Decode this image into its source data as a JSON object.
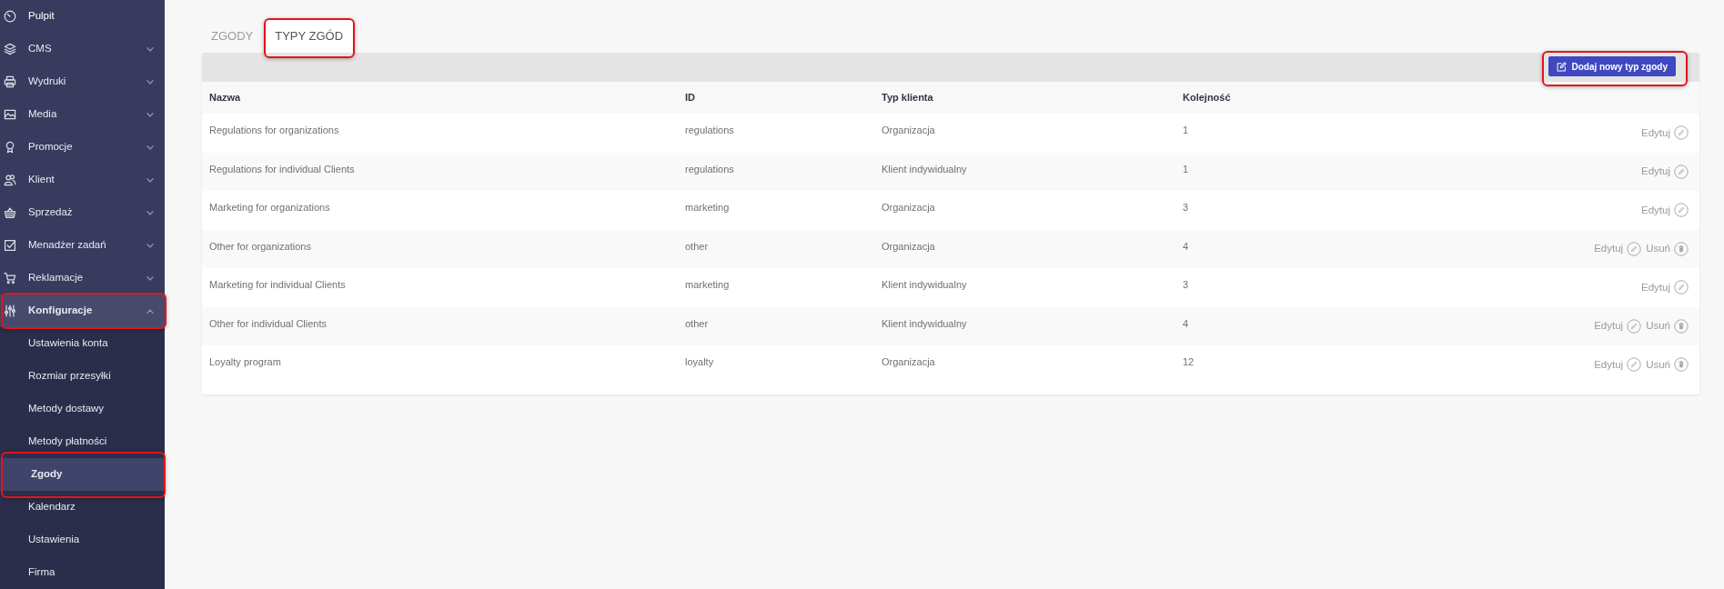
{
  "sidebar": {
    "items": [
      {
        "label": "Pulpit",
        "kind": "link",
        "highlighted": false
      },
      {
        "label": "CMS",
        "kind": "group",
        "expanded": false,
        "highlighted": false
      },
      {
        "label": "Wydruki",
        "kind": "group",
        "expanded": false,
        "highlighted": false
      },
      {
        "label": "Media",
        "kind": "group",
        "expanded": false,
        "highlighted": false
      },
      {
        "label": "Promocje",
        "kind": "group",
        "expanded": false,
        "highlighted": false
      },
      {
        "label": "Klient",
        "kind": "group",
        "expanded": false,
        "highlighted": false
      },
      {
        "label": "Sprzedaż",
        "kind": "group",
        "expanded": false,
        "highlighted": false
      },
      {
        "label": "Menadżer zadań",
        "kind": "group",
        "expanded": false,
        "highlighted": false
      },
      {
        "label": "Reklamacje",
        "kind": "group",
        "expanded": false,
        "highlighted": false
      },
      {
        "label": "Konfiguracje",
        "kind": "group",
        "expanded": true,
        "highlighted": true,
        "children": [
          {
            "label": "Ustawienia konta",
            "selected": false,
            "highlighted": false
          },
          {
            "label": "Rozmiar przesyłki",
            "selected": false,
            "highlighted": false
          },
          {
            "label": "Metody dostawy",
            "selected": false,
            "highlighted": false
          },
          {
            "label": "Metody płatności",
            "selected": false,
            "highlighted": false
          },
          {
            "label": "Zgody",
            "selected": true,
            "highlighted": true
          },
          {
            "label": "Kalendarz",
            "selected": false,
            "highlighted": false
          },
          {
            "label": "Ustawienia",
            "selected": false,
            "highlighted": false
          },
          {
            "label": "Firma",
            "selected": false,
            "highlighted": false
          }
        ]
      }
    ]
  },
  "tabs": [
    {
      "label": "ZGODY",
      "selected": false,
      "highlighted": false
    },
    {
      "label": "TYPY ZGÓD",
      "selected": true,
      "highlighted": true
    }
  ],
  "toolbar": {
    "add_button": {
      "label": "Dodaj nowy typ zgody",
      "highlighted": true
    }
  },
  "table": {
    "columns": [
      "Nazwa",
      "ID",
      "Typ klienta",
      "Kolejność"
    ],
    "rows": [
      {
        "cells": [
          "Regulations for organizations",
          "regulations",
          "Organizacja",
          "1"
        ],
        "actions": [
          {
            "label": "Edytuj",
            "kind": "edit"
          }
        ]
      },
      {
        "cells": [
          "Regulations for individual Clients",
          "regulations",
          "Klient indywidualny",
          "1"
        ],
        "actions": [
          {
            "label": "Edytuj",
            "kind": "edit"
          }
        ]
      },
      {
        "cells": [
          "Marketing for organizations",
          "marketing",
          "Organizacja",
          "3"
        ],
        "actions": [
          {
            "label": "Edytuj",
            "kind": "edit"
          }
        ]
      },
      {
        "cells": [
          "Other for organizations",
          "other",
          "Organizacja",
          "4"
        ],
        "actions": [
          {
            "label": "Edytuj",
            "kind": "edit"
          },
          {
            "label": "Usuń",
            "kind": "delete"
          }
        ]
      },
      {
        "cells": [
          "Marketing for individual Clients",
          "marketing",
          "Klient indywidualny",
          "3"
        ],
        "actions": [
          {
            "label": "Edytuj",
            "kind": "edit"
          }
        ]
      },
      {
        "cells": [
          "Other for individual Clients",
          "other",
          "Klient indywidualny",
          "4"
        ],
        "actions": [
          {
            "label": "Edytuj",
            "kind": "edit"
          },
          {
            "label": "Usuń",
            "kind": "delete"
          }
        ]
      },
      {
        "cells": [
          "Loyalty program",
          "loyalty",
          "Organizacja",
          "12"
        ],
        "actions": [
          {
            "label": "Edytuj",
            "kind": "edit"
          },
          {
            "label": "Usuń",
            "kind": "delete"
          }
        ]
      }
    ]
  }
}
